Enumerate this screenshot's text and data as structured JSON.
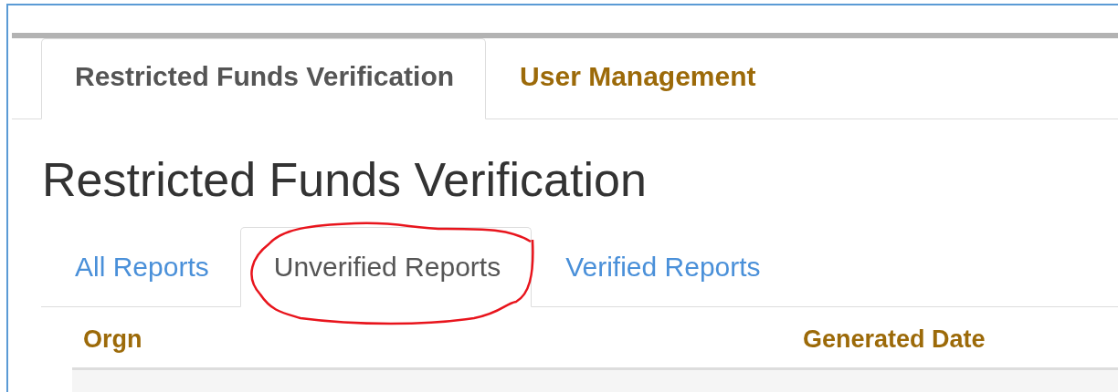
{
  "main_tabs": [
    {
      "label": "Restricted Funds Verification",
      "selected": true
    },
    {
      "label": "User Management",
      "selected": false
    }
  ],
  "heading": "Restricted Funds Verification",
  "report_tabs": [
    {
      "label": "All Reports",
      "selected": false
    },
    {
      "label": "Unverified Reports",
      "selected": true,
      "annotated": true
    },
    {
      "label": "Verified Reports",
      "selected": false
    }
  ],
  "table": {
    "columns": [
      "Orgn",
      "Generated Date"
    ]
  }
}
